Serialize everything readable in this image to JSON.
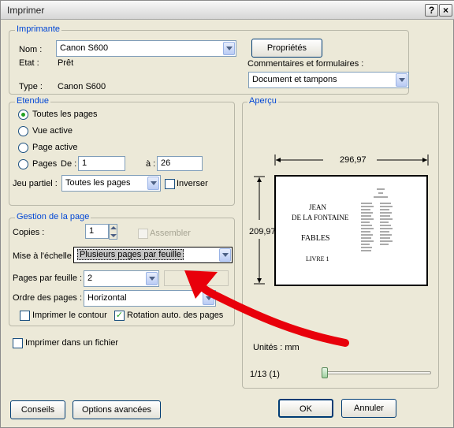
{
  "window": {
    "title": "Imprimer",
    "help_glyph": "?",
    "close_glyph": "×"
  },
  "printer": {
    "legend": "Imprimante",
    "name_label": "Nom :",
    "name_value": "Canon S600",
    "state_label": "Etat :",
    "state_value": "Prêt",
    "type_label": "Type :",
    "type_value": "Canon S600",
    "properties_button": "Propriétés",
    "comments_label": "Commentaires et formulaires :",
    "comments_value": "Document et tampons"
  },
  "range": {
    "legend": "Etendue",
    "all_pages": "Toutes les pages",
    "current_view": "Vue active",
    "current_page": "Page active",
    "pages": "Pages",
    "from_label": "De :",
    "from_value": "1",
    "to_label": "à :",
    "to_value": "26",
    "subset_label": "Jeu partiel :",
    "subset_value": "Toutes les pages",
    "reverse": "Inverser"
  },
  "page_handling": {
    "legend": "Gestion de la page",
    "copies_label": "Copies :",
    "copies_value": "1",
    "collate": "Assembler",
    "scaling_label": "Mise à l'échelle :",
    "scaling_value": "Plusieurs pages par feuille",
    "pages_per_sheet_label": "Pages par feuille :",
    "pages_per_sheet_value": "2",
    "page_order_label": "Ordre des pages :",
    "page_order_value": "Horizontal",
    "print_border": "Imprimer le contour",
    "auto_rotate": "Rotation auto. des pages"
  },
  "print_to_file": "Imprimer dans un fichier",
  "preview": {
    "legend": "Aperçu",
    "width_value": "296,97",
    "height_value": "209,97",
    "page_text": [
      "JEAN",
      "DE LA FONTAINE",
      "FABLES",
      "LIVRE 1"
    ],
    "units": "Unités : mm",
    "page_counter": "1/13 (1)"
  },
  "footer": {
    "tips_button": "Conseils",
    "advanced_button": "Options avancées",
    "ok_button": "OK",
    "cancel_button": "Annuler"
  },
  "colors": {
    "annotation_arrow": "#e8000b",
    "legend_blue": "#0046d5"
  }
}
